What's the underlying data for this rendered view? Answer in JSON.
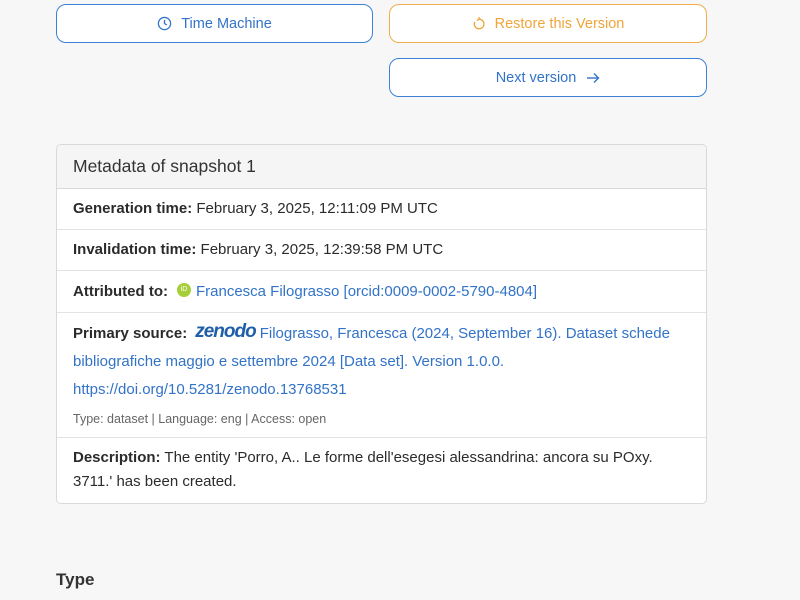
{
  "buttons": {
    "time_machine": "Time Machine",
    "restore": "Restore this Version",
    "next": "Next version"
  },
  "metadata": {
    "title": "Metadata of snapshot 1",
    "generation_label": "Generation time:",
    "generation_value": "February 3, 2025, 12:11:09 PM UTC",
    "invalidation_label": "Invalidation time:",
    "invalidation_value": "February 3, 2025, 12:39:58 PM UTC",
    "attributed_label": "Attributed to:",
    "attributed_value": "Francesca Filograsso [orcid:0009-0002-5790-4804]",
    "orcid_icon_text": "iD",
    "primary_label": "Primary source:",
    "zenodo_logo": "zenodo",
    "primary_line1": "Filograsso, Francesca (2024, September 16). Dataset schede",
    "primary_line2": "bibliografiche maggio e settembre 2024 [Data set]. Version 1.0.0.",
    "primary_line3": "https://doi.org/10.5281/zenodo.13768531",
    "primary_meta": "Type: dataset | Language: eng | Access: open",
    "description_label": "Description:",
    "description_value": "The entity 'Porro, A.. Le forme dell'esegesi alessandrina: ancora su POxy. 3711.' has been created."
  },
  "sections": {
    "type_heading": "Type"
  },
  "icons": {
    "time_machine": "clock-icon",
    "restore": "restore-icon",
    "next": "arrow-right-icon",
    "orcid": "orcid-icon",
    "zenodo": "zenodo-logo"
  },
  "colors": {
    "primary": "#3273c8",
    "warning": "#f0ad4e",
    "orcid": "#a6ce39"
  }
}
